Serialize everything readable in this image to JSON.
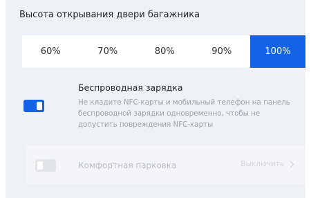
{
  "trunk": {
    "title": "Высота открывания двери багажника",
    "options": [
      "60%",
      "70%",
      "80%",
      "90%",
      "100%"
    ],
    "selected": "100%"
  },
  "wireless_charging": {
    "title": "Беспроводная зарядка",
    "description": "Не кладите NFC-карты и мобильный телефон на панель беспроводной зарядки одновременно, чтобы не допустить повреждения NFC-карты",
    "enabled": true
  },
  "comfort_parking": {
    "label": "Комфортная парковка",
    "action": "Выключить",
    "enabled": false,
    "disabled_state": true
  },
  "colors": {
    "accent": "#1463e6",
    "panel_bg": "#eef1f5",
    "text_primary": "#1f2328",
    "text_muted": "#9aa1a9"
  }
}
